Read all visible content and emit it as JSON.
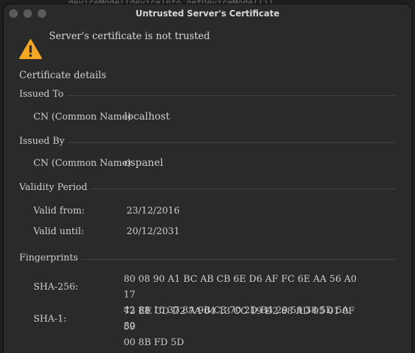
{
  "background": {
    "code_snippet": "deviceModel(deviceInfo.getDeviceModel())"
  },
  "window": {
    "title": "Untrusted Server's Certificate"
  },
  "alert": {
    "message": "Server's certificate is not trusted",
    "icon": "warning-icon"
  },
  "details": {
    "title": "Certificate details",
    "issued_to": {
      "header": "Issued To",
      "cn_label": "CN (Common Name)",
      "cn_value": "localhost"
    },
    "issued_by": {
      "header": "Issued By",
      "cn_label": "CN (Common Name)",
      "cn_value": "ospanel"
    },
    "validity": {
      "header": "Validity Period",
      "from_label": "Valid from:",
      "from_value": "23/12/2016",
      "until_label": "Valid until:",
      "until_value": "20/12/2031"
    },
    "fingerprints": {
      "header": "Fingerprints",
      "sha256_label": "SHA-256:",
      "sha256_line1": "80 08 90 A1 BC AB CB 6E D6 AF FC 6E AA 56 A0 17",
      "sha256_line2": "42 88 10 37 8A 9B C3 70 2D B4 29 59 38 5D 5A 80",
      "sha1_label": "SHA-1:",
      "sha1_line1": "73 EE CD D2 7A 04 13 CC 19 D2 68 AD 05 01 0F 59",
      "sha1_line2": "00 8B FD 5D"
    }
  },
  "colors": {
    "window_bg": "#2a2a2b",
    "text": "#cfcfcf",
    "warning": "#f5a623"
  }
}
